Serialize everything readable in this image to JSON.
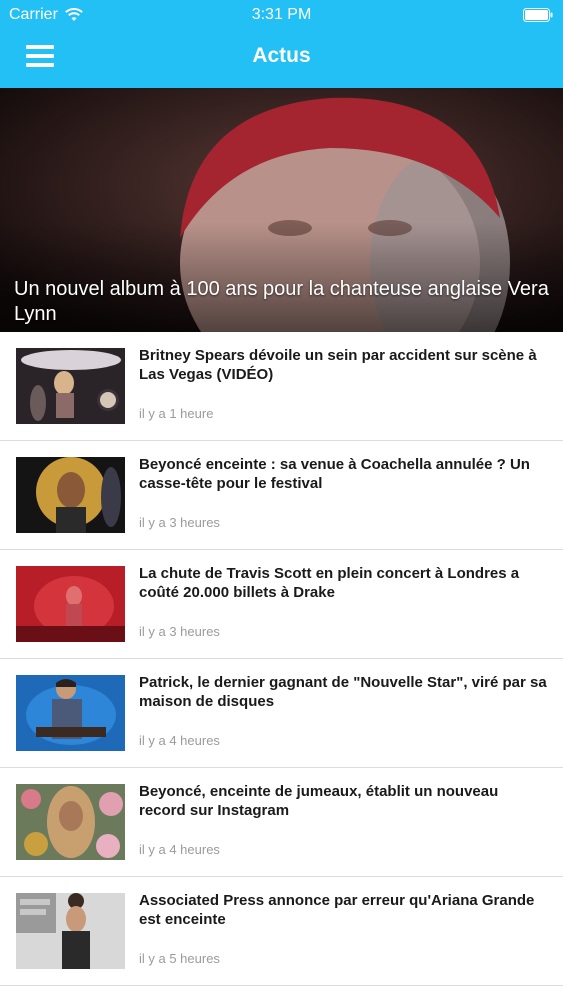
{
  "status_bar": {
    "carrier": "Carrier",
    "time": "3:31 PM"
  },
  "nav": {
    "title": "Actus",
    "accent_color": "#23c0f5"
  },
  "hero": {
    "caption": "Un nouvel album à 100 ans pour la chanteuse anglaise Vera Lynn"
  },
  "articles": [
    {
      "title": "Britney Spears dévoile un sein par accident sur scène à Las Vegas (VIDÉO)",
      "time": "il y a 1 heure"
    },
    {
      "title": "Beyoncé enceinte : sa venue à Coachella annulée ? Un casse-tête pour le festival",
      "time": "il y a 3 heures"
    },
    {
      "title": "La chute de Travis Scott en plein concert à Londres a coûté 20.000 billets à Drake",
      "time": "il y a 3 heures"
    },
    {
      "title": "Patrick, le dernier gagnant de \"Nouvelle Star\", viré par sa maison de disques",
      "time": "il y a 4 heures"
    },
    {
      "title": "Beyoncé, enceinte de jumeaux, établit un nouveau record sur Instagram",
      "time": "il y a 4 heures"
    },
    {
      "title": "Associated Press annonce par erreur qu'Ariana Grande est enceinte",
      "time": "il y a 5 heures"
    }
  ]
}
